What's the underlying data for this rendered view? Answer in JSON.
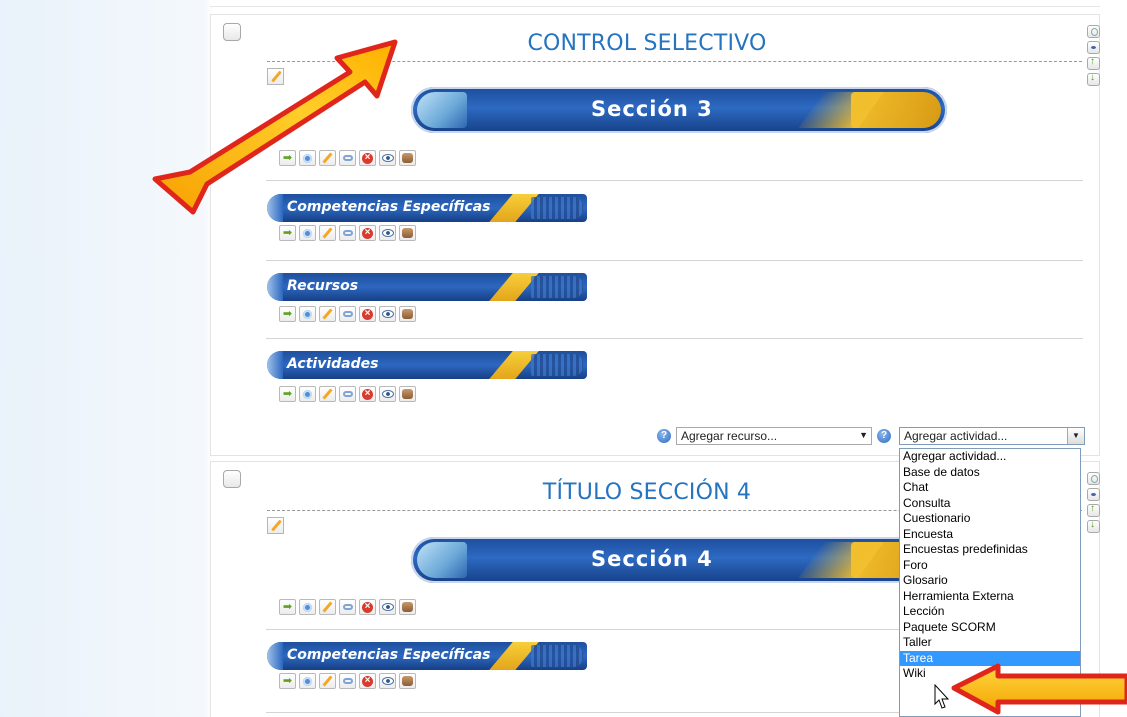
{
  "section3": {
    "title": "CONTROL SELECTIVO",
    "banner_title": "Sección 3",
    "subsections": [
      "Competencias Específicas",
      "Recursos",
      "Actividades"
    ]
  },
  "section4": {
    "title": "TÍTULO SECCIÓN 4",
    "banner_title": "Sección 4",
    "subsections": [
      "Competencias Específicas"
    ]
  },
  "add_controls": {
    "resource_select": "Agregar recurso...",
    "activity_select": "Agregar actividad...",
    "help_label": "?"
  },
  "activity_options": [
    "Agregar actividad...",
    "Base de datos",
    "Chat",
    "Consulta",
    "Cuestionario",
    "Encuesta",
    "Encuestas predefinidas",
    "Foro",
    "Glosario",
    "Herramienta Externa",
    "Lección",
    "Paquete SCORM",
    "Taller",
    "Tarea",
    "Wiki"
  ],
  "selected_activity": "Tarea",
  "colors": {
    "title_blue": "#2574bf",
    "banner_blue": "#1d4c9c",
    "banner_gold": "#f2c02e",
    "annotation_red": "#e0261b",
    "annotation_yellow": "#ffc21a",
    "highlight": "#3399ff"
  },
  "icons": {
    "row": [
      "move-right-icon",
      "move-icon",
      "edit-icon",
      "roles-icon",
      "delete-icon",
      "hide-icon",
      "group-icon"
    ],
    "side": [
      "highlight-icon",
      "show-icon",
      "move-up-icon",
      "move-down-icon"
    ]
  }
}
